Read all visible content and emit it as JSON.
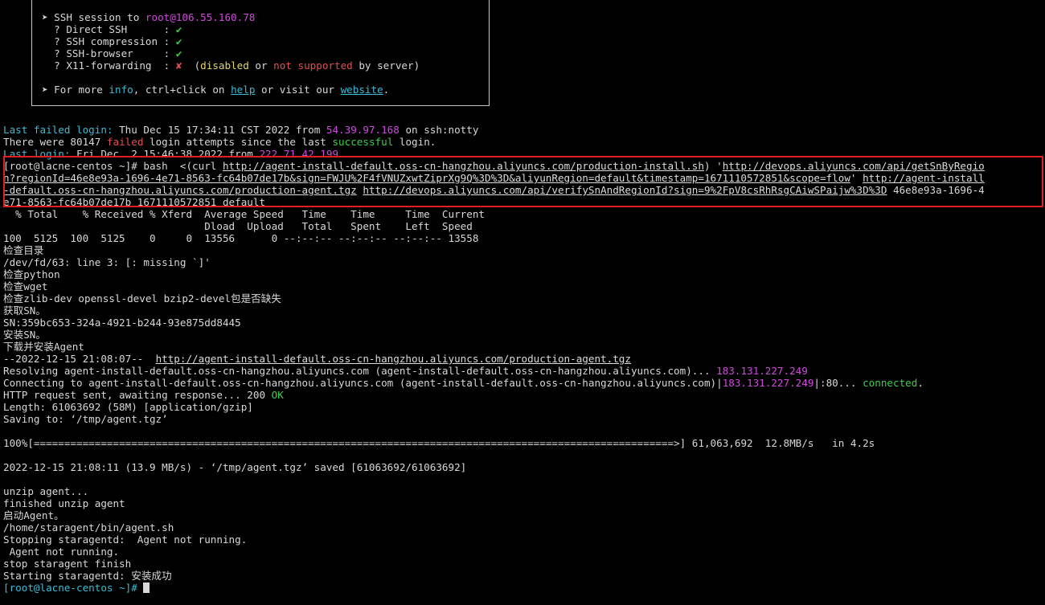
{
  "banner": {
    "session_prefix": "➤ SSH session to ",
    "session_host": "root@106.55.160.78",
    "features": [
      {
        "label": "  ? Direct SSH      : ",
        "mark": "✔"
      },
      {
        "label": "  ? SSH compression : ",
        "mark": "✔"
      },
      {
        "label": "  ? SSH-browser     : ",
        "mark": "✔"
      }
    ],
    "x11_label": "  ? X11-forwarding  : ",
    "x11_mark": "✘",
    "x11_note_open": "  (",
    "x11_disabled": "disabled",
    "x11_or": " or ",
    "x11_not_supported": "not supported",
    "x11_by_server": " by server)",
    "more_prefix": "➤ For more ",
    "more_info": "info",
    "more_mid": ", ctrl+click on ",
    "more_help": "help",
    "more_or": " or visit our ",
    "more_website": "website",
    "more_end": "."
  },
  "login": {
    "last_failed_label": "Last failed login:",
    "last_failed_date": " Thu Dec 15 17:34:11 CST 2022 from ",
    "last_failed_ip": "54.39.97.168",
    "last_failed_tail": " on ssh:notty",
    "attempts_prefix": "There were 80147 ",
    "attempts_failed": "failed",
    "attempts_mid": " login attempts since the last ",
    "attempts_success": "successful",
    "attempts_end": " login.",
    "last_login_label": "Last login:",
    "last_login_date": " Fri Dec  2 15:46:38 2022 from ",
    "last_login_ip": "222.71.42.199"
  },
  "command": {
    "prompt": "[root@lacne-centos ~]# ",
    "text1": "bash  <(curl ",
    "url1": "http://agent-install-default.oss-cn-hangzhou.aliyuncs.com/production-install.sh",
    "text2": ") '",
    "url2a": "http://devops.aliyuncs.com/api/getSnByRegio",
    "url2b": "n?regionId=46e8e93a-1696-4e71-8563-fc64b07de17b&sign=FWJU%2F4fVNUZxwtZiprXg9Q%3D%3D&aliyunRegion=default&timestamp=1671110572851&scope=flow",
    "text3": "' ",
    "url3a": "http://agent-install",
    "url3b": "-default.oss-cn-hangzhou.aliyuncs.com/production-agent.tgz",
    "text4": " ",
    "url4": "http://devops.aliyuncs.com/api/verifySnAndRegionId?sign=9%2FpV8csRhRsgCAiwSPaijw%3D%3D",
    "text5": " 46e8e93a-1696-4",
    "line4": "e71-8563-fc64b07de17b 1671110572851 default"
  },
  "curl": {
    "header1": "  % Total    % Received % Xferd  Average Speed   Time    Time     Time  Current",
    "header2": "                                 Dload  Upload   Total   Spent    Left  Speed",
    "row": "100  5125  100  5125    0     0  13556      0 --:--:-- --:--:-- --:--:-- 13558"
  },
  "output": {
    "check_dir": "检查目录",
    "fd_error": "/dev/fd/63: line 3: [: missing `]'",
    "check_python": "检查python",
    "check_wget": "检查wget",
    "check_libs": "检查zlib-dev openssl-devel bzip2-devel包是否缺失",
    "get_sn": "获取SN。",
    "sn": "SN:359bc653-324a-4921-b244-93e875dd8445",
    "install_sn": "安装SN。",
    "download_agent": "下载并安装Agent"
  },
  "wget": {
    "start_prefix": "--2022-12-15 21:08:07--  ",
    "start_url": "http://agent-install-default.oss-cn-hangzhou.aliyuncs.com/production-agent.tgz",
    "resolving": "Resolving agent-install-default.oss-cn-hangzhou.aliyuncs.com (agent-install-default.oss-cn-hangzhou.aliyuncs.com)... ",
    "resolving_ip": "183.131.227.249",
    "connecting": "Connecting to agent-install-default.oss-cn-hangzhou.aliyuncs.com (agent-install-default.oss-cn-hangzhou.aliyuncs.com)|",
    "connecting_ip": "183.131.227.249",
    "connecting_port": "|:80... ",
    "connected": "connected",
    "connected_end": ".",
    "http_request": "HTTP request sent, awaiting response... 200 ",
    "http_ok": "OK",
    "length": "Length: 61063692 (58M) [application/gzip]",
    "saving": "Saving to: ‘/tmp/agent.tgz’",
    "progress_prefix": "100%[",
    "progress_bar": "=========================================================================================================>",
    "progress_suffix": "] 61,063,692  12.8MB/s   in 4.2s",
    "saved": "2022-12-15 21:08:11 (13.9 MB/s) - ‘/tmp/agent.tgz’ saved [61063692/61063692]"
  },
  "post": {
    "unzip": "unzip agent...",
    "finished_unzip": "finished unzip agent",
    "start_agent": "启动Agent。",
    "agent_path": "/home/staragent/bin/agent.sh",
    "stopping": "Stopping staragentd:  Agent not running.",
    "not_running": " Agent not running.",
    "stop_finish": "stop staragent finish",
    "starting": "Starting staragentd: 安装成功"
  },
  "final_prompt": {
    "open": "[",
    "user": "root@lacne-centos ~",
    "close": "]# "
  }
}
